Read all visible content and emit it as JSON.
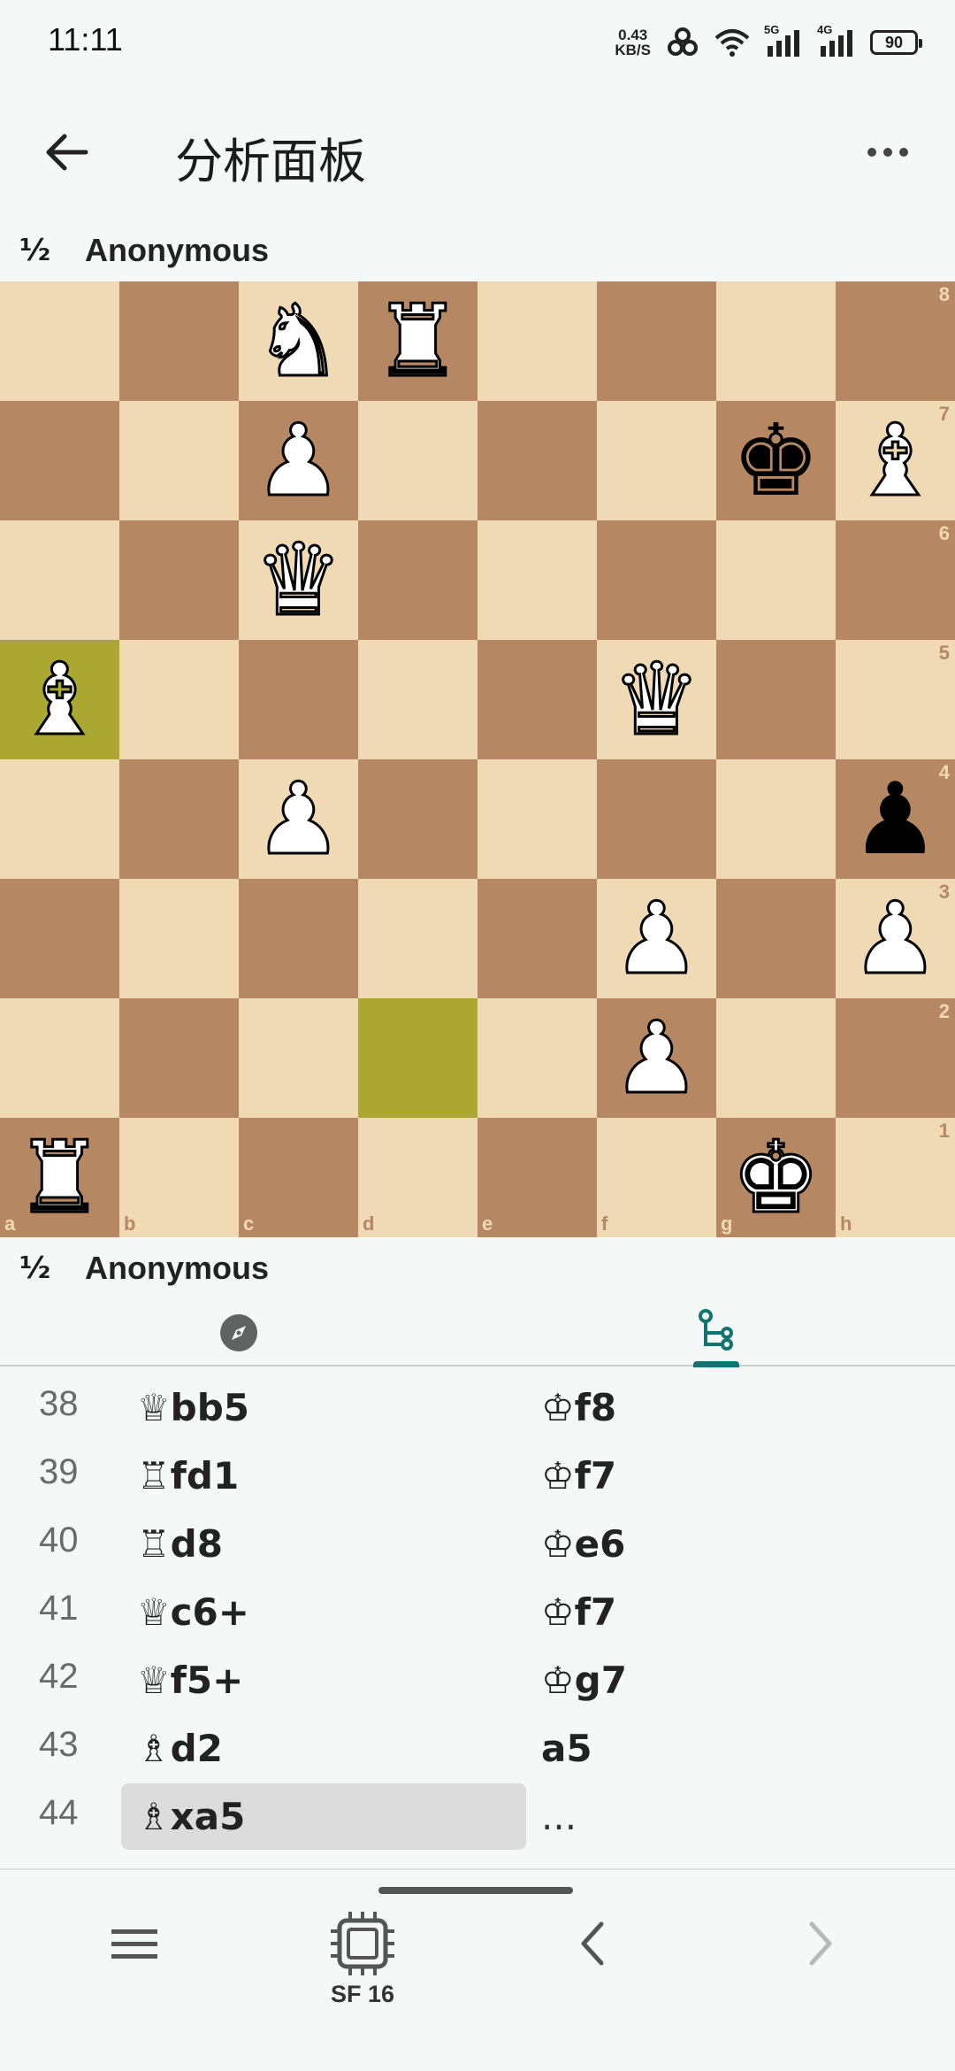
{
  "status_bar": {
    "time": "11:11",
    "net_speed_value": "0.43",
    "net_speed_unit": "KB/S",
    "signal_1_label": "5G",
    "signal_2_label": "4G",
    "battery": "90"
  },
  "app_bar": {
    "title": "分析面板"
  },
  "players": {
    "top": {
      "score": "½",
      "name": "Anonymous"
    },
    "bottom": {
      "score": "½",
      "name": "Anonymous"
    }
  },
  "board": {
    "files": [
      "a",
      "b",
      "c",
      "d",
      "e",
      "f",
      "g",
      "h"
    ],
    "ranks": [
      "8",
      "7",
      "6",
      "5",
      "4",
      "3",
      "2",
      "1"
    ],
    "highlight_squares": [
      "a5",
      "d2"
    ],
    "colors": {
      "light": "#f0d9b5",
      "dark": "#b58863",
      "highlight": "#aaa832"
    },
    "pieces": [
      {
        "square": "c8",
        "glyph": "♞",
        "color": "white",
        "name": "white-knight"
      },
      {
        "square": "d8",
        "glyph": "♜",
        "color": "white",
        "name": "white-rook"
      },
      {
        "square": "c7",
        "glyph": "♟",
        "color": "white",
        "name": "white-pawn"
      },
      {
        "square": "g7",
        "glyph": "♚",
        "color": "black",
        "name": "black-king"
      },
      {
        "square": "h7",
        "glyph": "♝",
        "color": "white",
        "name": "white-bishop"
      },
      {
        "square": "c6",
        "glyph": "♛",
        "color": "white",
        "name": "white-queen"
      },
      {
        "square": "a5",
        "glyph": "♝",
        "color": "white",
        "name": "white-bishop"
      },
      {
        "square": "f5",
        "glyph": "♛",
        "color": "white",
        "name": "white-queen"
      },
      {
        "square": "c4",
        "glyph": "♟",
        "color": "white",
        "name": "white-pawn"
      },
      {
        "square": "h4",
        "glyph": "♟",
        "color": "black",
        "name": "black-pawn"
      },
      {
        "square": "f3",
        "glyph": "♟",
        "color": "white",
        "name": "white-pawn"
      },
      {
        "square": "h3",
        "glyph": "♟",
        "color": "white",
        "name": "white-pawn"
      },
      {
        "square": "f2",
        "glyph": "♟",
        "color": "white",
        "name": "white-pawn"
      },
      {
        "square": "a1",
        "glyph": "♜",
        "color": "white",
        "name": "white-rook"
      },
      {
        "square": "g1",
        "glyph": "♚",
        "color": "white",
        "name": "white-king"
      }
    ]
  },
  "tabs": {
    "left_icon": "compass-icon",
    "right_icon": "move-tree-icon",
    "accent": "#11746e"
  },
  "moves": [
    {
      "num": "38",
      "white": "♕bb5",
      "black": "♔f8"
    },
    {
      "num": "39",
      "white": "♖fd1",
      "black": "♔f7"
    },
    {
      "num": "40",
      "white": "♖d8",
      "black": "♔e6"
    },
    {
      "num": "41",
      "white": "♕c6+",
      "black": "♔f7"
    },
    {
      "num": "42",
      "white": "♕f5+",
      "black": "♔g7"
    },
    {
      "num": "43",
      "white": "♗d2",
      "black": "a5"
    },
    {
      "num": "44",
      "white": "♗xa5",
      "black": "..."
    }
  ],
  "bottom_bar": {
    "menu_icon": "menu-icon",
    "engine_icon": "cpu-icon",
    "engine_label": "SF 16",
    "prev_icon": "chevron-left-icon",
    "next_icon": "chevron-right-icon"
  }
}
